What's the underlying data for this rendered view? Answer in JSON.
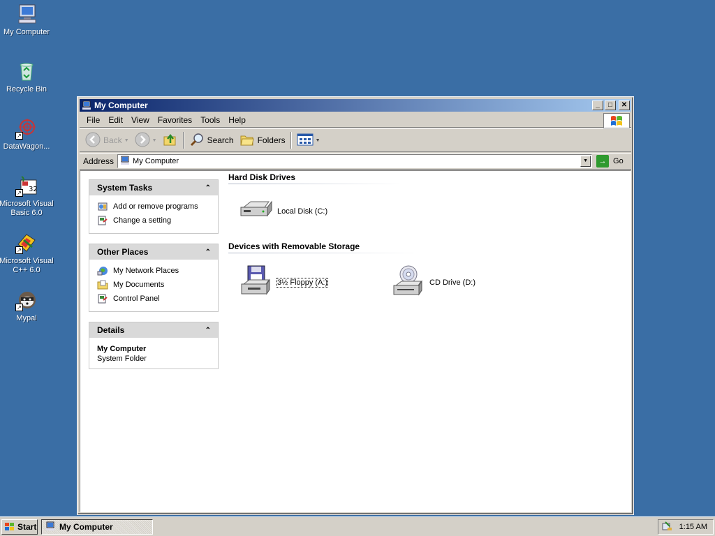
{
  "desktop": {
    "icons": [
      {
        "label": "My Computer",
        "icon": "my-computer-icon"
      },
      {
        "label": "Recycle Bin",
        "icon": "recycle-bin-icon"
      },
      {
        "label": "DataWagon...",
        "icon": "datawagon-icon"
      },
      {
        "label": "Microsoft Visual Basic 6.0",
        "icon": "visual-basic-icon"
      },
      {
        "label": "Microsoft Visual C++ 6.0",
        "icon": "visual-cpp-icon"
      },
      {
        "label": "Mypal",
        "icon": "mypal-icon"
      }
    ]
  },
  "window": {
    "title": "My Computer",
    "title_buttons": {
      "minimize": "_",
      "maximize": "□",
      "close": "✕"
    },
    "menu": [
      "File",
      "Edit",
      "View",
      "Favorites",
      "Tools",
      "Help"
    ],
    "toolbar": {
      "back": "Back",
      "search": "Search",
      "folders": "Folders"
    },
    "address": {
      "label": "Address",
      "value": "My Computer",
      "go": "Go"
    },
    "system_tasks": {
      "title": "System Tasks",
      "items": [
        "Add or remove programs",
        "Change a setting"
      ]
    },
    "other_places": {
      "title": "Other Places",
      "items": [
        "My Network Places",
        "My Documents",
        "Control Panel"
      ]
    },
    "details": {
      "title": "Details",
      "name": "My Computer",
      "type": "System Folder"
    },
    "groups": {
      "hard_disks": {
        "title": "Hard Disk Drives",
        "items": [
          "Local Disk (C:)"
        ]
      },
      "removable": {
        "title": "Devices with Removable Storage",
        "items": [
          "3½ Floppy (A:)",
          "CD Drive (D:)"
        ]
      }
    }
  },
  "taskbar": {
    "start": "Start",
    "task": "My Computer",
    "clock": "1:15 AM"
  },
  "colors": {
    "desktop": "#3a6ea5",
    "titlebar_start": "#0a246a",
    "titlebar_end": "#a6caf0",
    "face": "#d4d0c8"
  }
}
